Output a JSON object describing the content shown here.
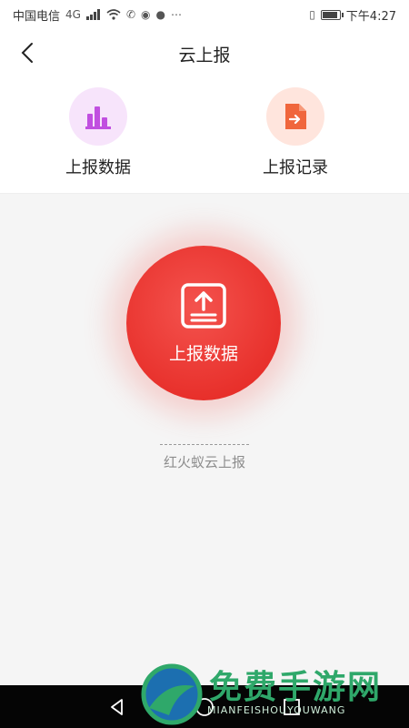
{
  "status_bar": {
    "carrier": "中国电信",
    "network": "4G",
    "time": "下午4:27",
    "battery_level": 0.8
  },
  "header": {
    "title": "云上报",
    "back_icon": "back-arrow-icon"
  },
  "quick_actions": [
    {
      "label": "上报数据",
      "icon": "bar-chart-icon",
      "color": "#c14fe0"
    },
    {
      "label": "上报记录",
      "icon": "file-export-icon",
      "color": "#f0663c"
    }
  ],
  "main": {
    "upload_label": "上报数据",
    "upload_icon": "upload-box-icon",
    "caption": "红火蚁云上报",
    "accent": "#e8312c"
  },
  "watermark": {
    "text": "免费手游网",
    "subtext": "MIANFEISHOUYOUWANG"
  }
}
